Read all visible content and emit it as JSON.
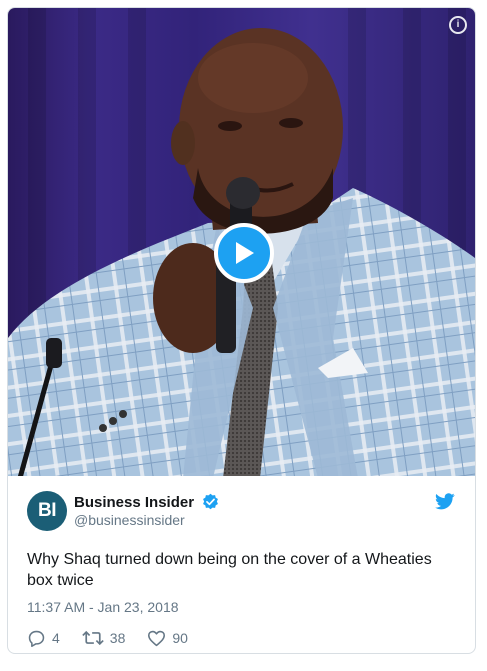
{
  "media": {
    "info_icon": "info-icon",
    "play_icon": "play-icon"
  },
  "author": {
    "avatar_text": "BI",
    "name": "Business Insider",
    "handle": "@businessinsider",
    "verified_icon": "verified-badge-icon",
    "platform_icon": "twitter-bird-icon"
  },
  "tweet": {
    "text": "Why Shaq turned down being on the cover of a Wheaties box twice",
    "timestamp": "11:37 AM - Jan 23, 2018"
  },
  "actions": {
    "replies": "4",
    "retweets": "38",
    "likes": "90"
  },
  "colors": {
    "twitter_blue": "#1da1f2",
    "avatar_bg": "#1b5e76",
    "muted_text": "#657786"
  }
}
